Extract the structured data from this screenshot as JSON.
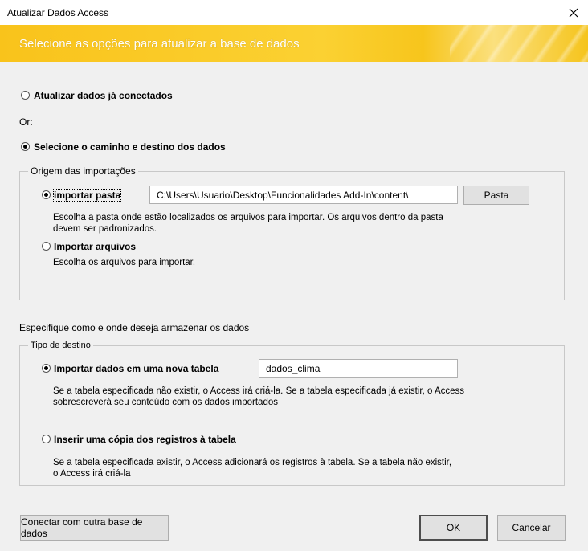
{
  "window": {
    "title": "Atualizar Dados Access"
  },
  "banner": {
    "heading": "Selecione as opções para atualizar a base de dados",
    "accent_color": "#f9c31b"
  },
  "mode": {
    "option_connected": "Atualizar dados já conectados",
    "or_label": "Or:",
    "option_select_path": "Selecione o caminho e destino dos dados",
    "selected": "option_select_path"
  },
  "origin": {
    "legend": "Origem das importações",
    "option_folder": "importar pasta",
    "folder_path": "C:\\Users\\Usuario\\Desktop\\Funcionalidades Add-In\\content\\",
    "folder_button": "Pasta",
    "folder_desc_line1": "Escolha a pasta onde estão localizados os arquivos para importar. Os arquivos dentro da pasta",
    "folder_desc_line2": "devem ser padronizados.",
    "option_files": "Importar arquivos",
    "files_desc": "Escolha os arquivos para importar.",
    "selected": "option_folder"
  },
  "storage": {
    "label": "Especifique como e onde deseja armazenar os dados"
  },
  "destination": {
    "legend": "Tipo de destino",
    "option_new_table": "Importar dados em uma nova tabela",
    "table_name": "dados_clima",
    "new_table_desc_line1": "Se a tabela especificada não existir, o Access irá criá-la. Se a tabela especificada já existir, o Access",
    "new_table_desc_line2": "sobrescreverá seu conteúdo com os dados importados",
    "option_insert_copy": "Inserir uma cópia dos registros à tabela",
    "insert_desc_line1": "Se a tabela especificada existir, o Access adicionará os registros à tabela. Se a tabela não existir,",
    "insert_desc_line2": "o Access irá criá-la",
    "selected": "option_new_table"
  },
  "footer": {
    "connect_other": "Conectar com outra base de dados",
    "ok": "OK",
    "cancel": "Cancelar"
  }
}
